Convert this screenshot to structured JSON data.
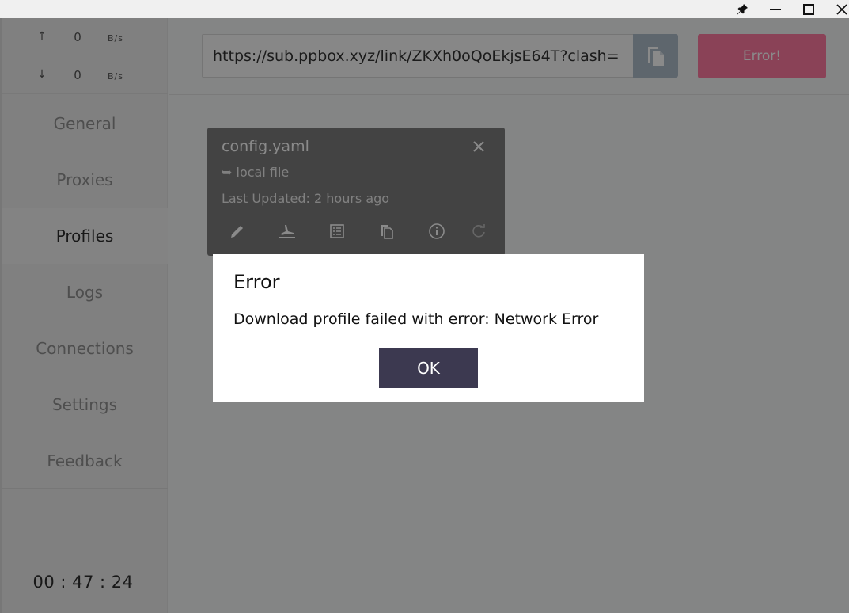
{
  "titlebar": {
    "pin_icon": "pin-icon",
    "minimize_icon": "minimize-icon",
    "maximize_icon": "maximize-icon",
    "close_icon": "close-icon"
  },
  "sidebar": {
    "traffic": {
      "up_arrow": "↑",
      "up_value": "0",
      "up_unit": "B/s",
      "down_arrow": "↓",
      "down_value": "0",
      "down_unit": "B/s"
    },
    "items": [
      {
        "label": "General"
      },
      {
        "label": "Proxies"
      },
      {
        "label": "Profiles"
      },
      {
        "label": "Logs"
      },
      {
        "label": "Connections"
      },
      {
        "label": "Settings"
      },
      {
        "label": "Feedback"
      }
    ],
    "active_item": "Profiles",
    "clock": "00 : 47 : 24"
  },
  "topbar": {
    "url_value": "https://sub.ppbox.xyz/link/ZKXh0oQoEkjsE64T?clash=",
    "paste_icon": "paste-icon",
    "download_button_label": "Error!",
    "download_button_color": "#ff7aa2"
  },
  "profile_card": {
    "name": "config.yaml",
    "source": "➥ local file",
    "updated": "Last Updated: 2 hours ago",
    "actions": [
      "edit-icon",
      "parse-icon",
      "view-icon",
      "copy-icon",
      "info-icon",
      "refresh-icon"
    ]
  },
  "dialog": {
    "title": "Error",
    "message": "Download profile failed with error: Network Error",
    "ok_label": "OK"
  },
  "colors": {
    "accent_error": "#ff7aa2",
    "dialog_button": "#3c3950",
    "paste_button": "#aebcca"
  }
}
